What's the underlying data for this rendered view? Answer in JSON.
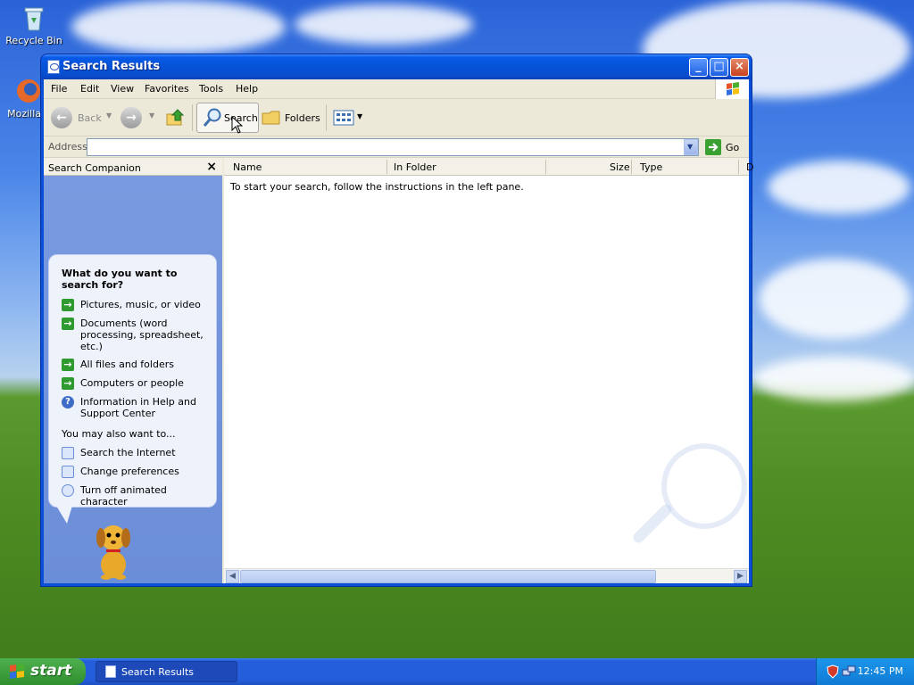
{
  "desktop": {
    "icons": [
      {
        "label": "Recycle Bin",
        "icon": "recycle-bin-icon"
      },
      {
        "label": "Mozilla F",
        "icon": "firefox-icon"
      }
    ]
  },
  "window": {
    "title": "Search Results",
    "menu": [
      "File",
      "Edit",
      "View",
      "Favorites",
      "Tools",
      "Help"
    ],
    "toolbar": {
      "back_label": "Back",
      "search_label": "Search",
      "folders_label": "Folders"
    },
    "address": {
      "label": "Address",
      "value": "",
      "go_label": "Go"
    },
    "companion": {
      "header": "Search Companion",
      "question": "What do you want to search for?",
      "options": [
        {
          "label": "Pictures, music, or video",
          "icon": "green-arrow-icon"
        },
        {
          "label": "Documents (word processing, spreadsheet, etc.)",
          "icon": "green-arrow-icon"
        },
        {
          "label": "All files and folders",
          "icon": "green-arrow-icon"
        },
        {
          "label": "Computers or people",
          "icon": "green-arrow-icon"
        },
        {
          "label": "Information in Help and Support Center",
          "icon": "help-icon"
        }
      ],
      "also_label": "You may also want to...",
      "also": [
        {
          "label": "Search the Internet",
          "icon": "internet-search-icon"
        },
        {
          "label": "Change preferences",
          "icon": "preferences-icon"
        },
        {
          "label": "Turn off animated character",
          "icon": "animated-character-icon"
        }
      ]
    },
    "results": {
      "columns": [
        "Name",
        "In Folder",
        "Size",
        "Type",
        "D"
      ],
      "hint": "To start your search, follow the instructions in the left pane."
    }
  },
  "taskbar": {
    "start_label": "start",
    "task_title": "Search Results",
    "clock": "12:45 PM"
  },
  "colors": {
    "title_blue": "#0a5ae8",
    "pane_blue": "#7a9ae0",
    "start_green": "#3fa03f",
    "taskbar_blue": "#245edb"
  }
}
